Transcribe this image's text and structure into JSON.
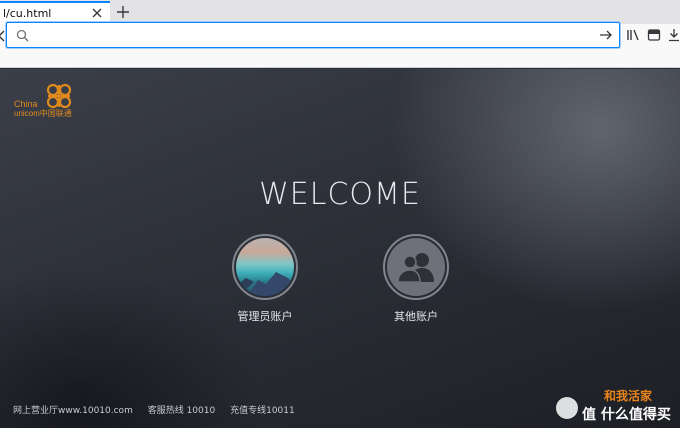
{
  "browser": {
    "tab_title": "l/cu.html",
    "url_value": "",
    "url_placeholder": ""
  },
  "logo": {
    "line1": "China",
    "line2": "unicom中国联通",
    "color": "#e08a1e"
  },
  "page": {
    "welcome": "WELCOME",
    "accounts": [
      {
        "label": "管理员账户",
        "icon": "landscape-avatar"
      },
      {
        "label": "其他账户",
        "icon": "users-icon"
      }
    ],
    "footer": {
      "hall": "网上营业厅www.10010.com",
      "hotline": "客服热线 10010",
      "recharge": "充值专线10011"
    }
  },
  "watermark": {
    "top": "和我活家",
    "bottom": "值 什么值得买"
  }
}
